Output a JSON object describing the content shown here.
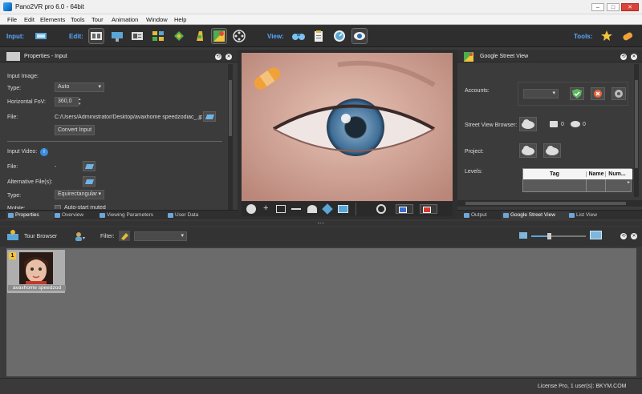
{
  "window": {
    "title": "Pano2VR pro 6.0 - 64bit",
    "min": "–",
    "max": "□",
    "close": "✕"
  },
  "menu": [
    "File",
    "Edit",
    "Elements",
    "Tools",
    "Tour",
    "Animation",
    "Window",
    "Help"
  ],
  "toolbar": {
    "input_label": "Input:",
    "edit_label": "Edit:",
    "view_label": "View:",
    "tools_label": "Tools:"
  },
  "properties": {
    "title": "Properties - Input",
    "input_image_heading": "Input Image:",
    "type_label": "Type:",
    "type_value": "Auto",
    "fov_label": "Horizontal FoV:",
    "fov_value": "360,0",
    "file_label": "File:",
    "file_value": "C:/Users/Administrator/Desktop/avaxhome speedzodiac_.jpg",
    "convert_button": "Convert Input",
    "input_video_heading": "Input Video:",
    "video_file_label": "File:",
    "video_file_value": "-",
    "alt_files_label": "Alternative File(s):",
    "video_type_label": "Type:",
    "video_type_value": "Equirectangular",
    "mobile_label": "Mobile:",
    "autostart_label": "Auto-start muted"
  },
  "left_tabs": [
    "Properties",
    "Overview",
    "Viewing Parameters",
    "User Data"
  ],
  "gsv": {
    "title": "Google Street View",
    "accounts_label": "Accounts:",
    "browser_label": "Street View Browser:",
    "photo_count": "0",
    "view_count": "0",
    "project_label": "Project:",
    "levels_label": "Levels:",
    "columns": [
      "Tag",
      "Name",
      "Num..."
    ]
  },
  "right_tabs": [
    "Output",
    "Google Street View",
    "List View"
  ],
  "tour_browser": {
    "title": "Tour Browser",
    "filter_label": "Filter:",
    "thumb_badge": "1",
    "thumb_caption": "avaxhome speedzod"
  },
  "status": {
    "license": "License Pro, 1 user(s): BKYM.COM"
  },
  "colors": {
    "accent": "#58a8ff",
    "panel": "#3b3b3b",
    "workspace": "#6b6b6b"
  }
}
